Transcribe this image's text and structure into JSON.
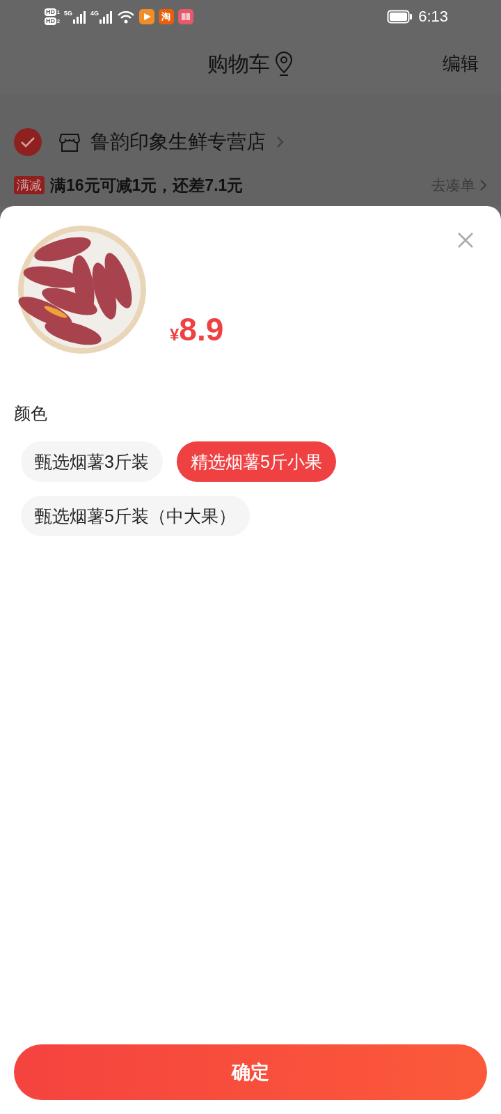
{
  "status_bar": {
    "sims": [
      {
        "label": "HD",
        "slot": "1"
      },
      {
        "label": "HD",
        "slot": "2"
      }
    ],
    "networks": [
      "5G",
      "4G"
    ],
    "notification_icons": [
      {
        "kind": "video"
      },
      {
        "kind": "taobao",
        "label": "淘"
      },
      {
        "kind": "book"
      }
    ],
    "time": "6:13"
  },
  "header": {
    "title": "购物车",
    "action": "编辑"
  },
  "shop": {
    "checked": true,
    "name": "鲁韵印象生鲜专营店"
  },
  "promo": {
    "badge": "满减",
    "text": "满16元可减1元，还差7.1元",
    "link": "去凑单"
  },
  "sheet": {
    "currency": "¥",
    "price": "8.9",
    "option_group": "颜色",
    "options": [
      {
        "label": "甄选烟薯3斤装",
        "selected": false
      },
      {
        "label": "精选烟薯5斤小果",
        "selected": true
      },
      {
        "label": "甄选烟薯5斤装（中大果）",
        "selected": false
      }
    ],
    "confirm": "确定"
  }
}
